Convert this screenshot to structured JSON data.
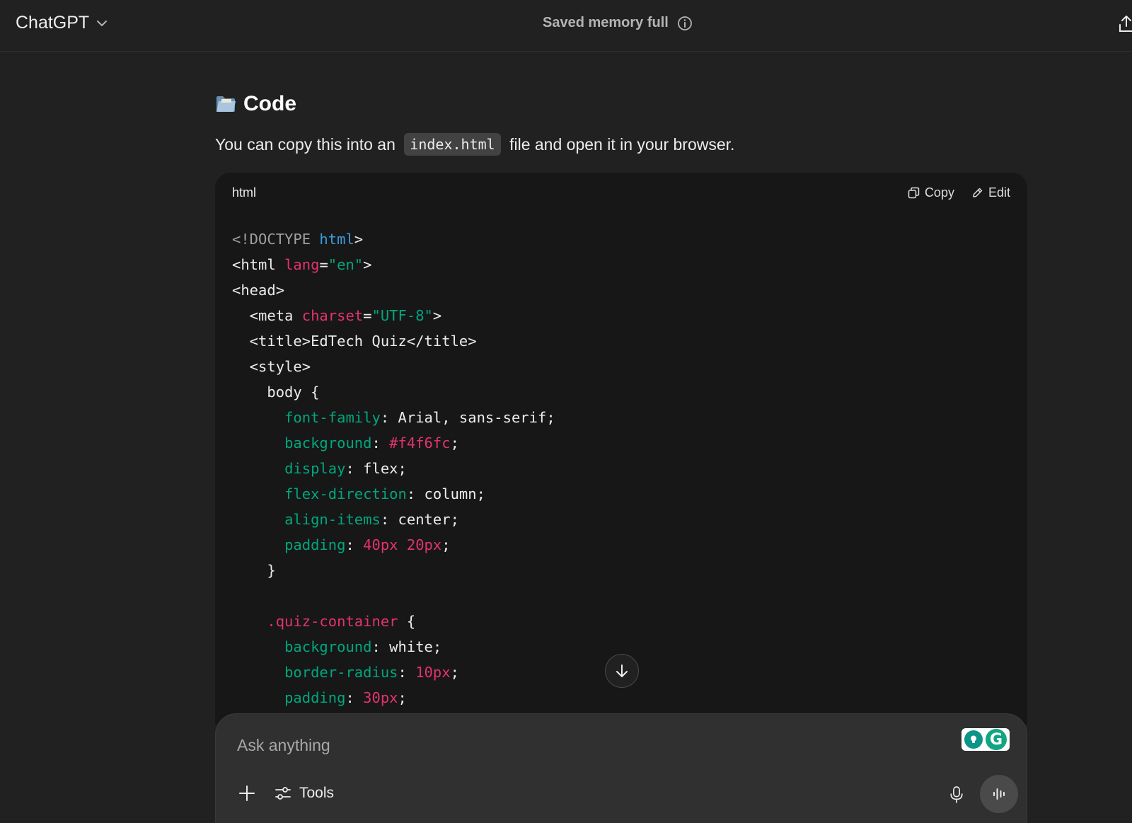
{
  "header": {
    "model_name": "ChatGPT",
    "memory_status": "Saved memory full"
  },
  "message": {
    "section_emoji_icon": "folder-icon",
    "section_title": "Code",
    "intro_before": "You can copy this into an ",
    "intro_code": "index.html",
    "intro_after": " file and open it in your browser."
  },
  "code_block": {
    "language": "html",
    "copy_label": "Copy",
    "edit_label": "Edit",
    "lines": [
      [
        [
          "t-doctype",
          "<!DOCTYPE "
        ],
        [
          "t-kw",
          "html"
        ],
        [
          "t-tag",
          ">"
        ]
      ],
      [
        [
          "t-tag",
          "<html "
        ],
        [
          "t-attr",
          "lang"
        ],
        [
          "t-tag",
          "="
        ],
        [
          "t-str",
          "\"en\""
        ],
        [
          "t-tag",
          ">"
        ]
      ],
      [
        [
          "t-tag",
          "<head>"
        ]
      ],
      [
        [
          "t-tag",
          "  <meta "
        ],
        [
          "t-attr",
          "charset"
        ],
        [
          "t-tag",
          "="
        ],
        [
          "t-str",
          "\"UTF-8\""
        ],
        [
          "t-tag",
          ">"
        ]
      ],
      [
        [
          "t-tag",
          "  <title>"
        ],
        [
          "t-plain",
          "EdTech Quiz"
        ],
        [
          "t-tag",
          "</title>"
        ]
      ],
      [
        [
          "t-tag",
          "  <style>"
        ]
      ],
      [
        [
          "t-plain",
          "    body {"
        ]
      ],
      [
        [
          "t-plain",
          "      "
        ],
        [
          "t-prop",
          "font-family"
        ],
        [
          "t-plain",
          ": Arial, sans-serif;"
        ]
      ],
      [
        [
          "t-plain",
          "      "
        ],
        [
          "t-prop",
          "background"
        ],
        [
          "t-plain",
          ": "
        ],
        [
          "t-num",
          "#f4f6fc"
        ],
        [
          "t-plain",
          ";"
        ]
      ],
      [
        [
          "t-plain",
          "      "
        ],
        [
          "t-prop",
          "display"
        ],
        [
          "t-plain",
          ": flex;"
        ]
      ],
      [
        [
          "t-plain",
          "      "
        ],
        [
          "t-prop",
          "flex-direction"
        ],
        [
          "t-plain",
          ": column;"
        ]
      ],
      [
        [
          "t-plain",
          "      "
        ],
        [
          "t-prop",
          "align-items"
        ],
        [
          "t-plain",
          ": center;"
        ]
      ],
      [
        [
          "t-plain",
          "      "
        ],
        [
          "t-prop",
          "padding"
        ],
        [
          "t-plain",
          ": "
        ],
        [
          "t-num",
          "40px"
        ],
        [
          "t-plain",
          " "
        ],
        [
          "t-num",
          "20px"
        ],
        [
          "t-plain",
          ";"
        ]
      ],
      [
        [
          "t-plain",
          "    }"
        ]
      ],
      [
        [
          "t-plain",
          ""
        ]
      ],
      [
        [
          "t-plain",
          "    "
        ],
        [
          "t-sel",
          ".quiz-container"
        ],
        [
          "t-plain",
          " {"
        ]
      ],
      [
        [
          "t-plain",
          "      "
        ],
        [
          "t-prop",
          "background"
        ],
        [
          "t-plain",
          ": white;"
        ]
      ],
      [
        [
          "t-plain",
          "      "
        ],
        [
          "t-prop",
          "border-radius"
        ],
        [
          "t-plain",
          ": "
        ],
        [
          "t-num",
          "10px"
        ],
        [
          "t-plain",
          ";"
        ]
      ],
      [
        [
          "t-plain",
          "      "
        ],
        [
          "t-prop",
          "padding"
        ],
        [
          "t-plain",
          ": "
        ],
        [
          "t-num",
          "30px"
        ],
        [
          "t-plain",
          ";"
        ]
      ]
    ]
  },
  "composer": {
    "placeholder": "Ask anything",
    "tools_label": "Tools"
  },
  "colors": {
    "background": "#212121",
    "code_background": "#171717",
    "composer_background": "#303030",
    "syntax_property": "#00a67d",
    "syntax_number": "#e2336b",
    "syntax_keyword": "#3b9bde"
  }
}
